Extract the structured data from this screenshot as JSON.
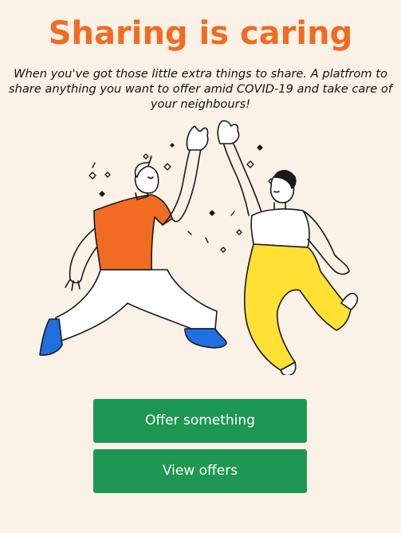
{
  "page": {
    "title": "Sharing is caring",
    "subtitle": "When you've got those little extra things to share. A platfrom to share anything you want to offer amid COVID-19 and take care of your neighbours!"
  },
  "illustration": {
    "icon": "high-five-illustration",
    "colors": {
      "left_shirt": "#f26b22",
      "left_shoes": "#1f6fe0",
      "right_pants": "#ffe033",
      "outline": "#1a1a1a"
    }
  },
  "actions": {
    "offer_label": "Offer something",
    "view_label": "View offers"
  },
  "theme": {
    "background": "#fbf2e7",
    "title_color": "#f26b22",
    "button_color": "#1e9752",
    "button_text": "#ffffff"
  }
}
